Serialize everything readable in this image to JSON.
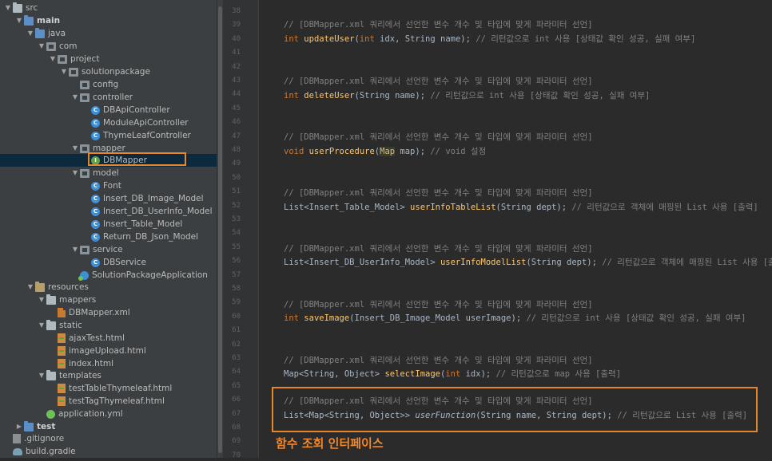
{
  "tree": {
    "items": [
      {
        "label": "src",
        "icon": "folder-icon",
        "indent": 0,
        "arrow": "down",
        "bold": false
      },
      {
        "label": "main",
        "icon": "srcfolder-icon",
        "indent": 1,
        "arrow": "down",
        "bold": true
      },
      {
        "label": "java",
        "icon": "srcfolder-icon",
        "indent": 2,
        "arrow": "down",
        "bold": false
      },
      {
        "label": "com",
        "icon": "pkg-icon",
        "indent": 3,
        "arrow": "down",
        "bold": false
      },
      {
        "label": "project",
        "icon": "pkg-icon",
        "indent": 4,
        "arrow": "down",
        "bold": false
      },
      {
        "label": "solutionpackage",
        "icon": "pkg-icon",
        "indent": 5,
        "arrow": "down",
        "bold": false
      },
      {
        "label": "config",
        "icon": "pkg-icon",
        "indent": 6,
        "arrow": "none",
        "bold": false
      },
      {
        "label": "controller",
        "icon": "pkg-icon",
        "indent": 6,
        "arrow": "down",
        "bold": false
      },
      {
        "label": "DBApiController",
        "icon": "class-icon",
        "indent": 7,
        "arrow": "none",
        "bold": false
      },
      {
        "label": "ModuleApiController",
        "icon": "class-icon",
        "indent": 7,
        "arrow": "none",
        "bold": false
      },
      {
        "label": "ThymeLeafController",
        "icon": "class-icon",
        "indent": 7,
        "arrow": "none",
        "bold": false
      },
      {
        "label": "mapper",
        "icon": "pkg-icon",
        "indent": 6,
        "arrow": "down",
        "bold": false
      },
      {
        "label": "DBMapper",
        "icon": "iface-icon",
        "indent": 7,
        "arrow": "none",
        "bold": false
      },
      {
        "label": "model",
        "icon": "pkg-icon",
        "indent": 6,
        "arrow": "down",
        "bold": false
      },
      {
        "label": "Font",
        "icon": "class-icon",
        "indent": 7,
        "arrow": "none",
        "bold": false
      },
      {
        "label": "Insert_DB_Image_Model",
        "icon": "class-icon",
        "indent": 7,
        "arrow": "none",
        "bold": false
      },
      {
        "label": "Insert_DB_UserInfo_Model",
        "icon": "class-icon",
        "indent": 7,
        "arrow": "none",
        "bold": false
      },
      {
        "label": "Insert_Table_Model",
        "icon": "class-icon",
        "indent": 7,
        "arrow": "none",
        "bold": false
      },
      {
        "label": "Return_DB_Json_Model",
        "icon": "class-icon",
        "indent": 7,
        "arrow": "none",
        "bold": false
      },
      {
        "label": "service",
        "icon": "pkg-icon",
        "indent": 6,
        "arrow": "down",
        "bold": false
      },
      {
        "label": "DBService",
        "icon": "class-icon",
        "indent": 7,
        "arrow": "none",
        "bold": false
      },
      {
        "label": "SolutionPackageApplication",
        "icon": "app-icon",
        "indent": 6,
        "arrow": "none",
        "bold": false
      },
      {
        "label": "resources",
        "icon": "resfolder-icon",
        "indent": 2,
        "arrow": "down",
        "bold": false
      },
      {
        "label": "mappers",
        "icon": "folder-icon",
        "indent": 3,
        "arrow": "down",
        "bold": false
      },
      {
        "label": "DBMapper.xml",
        "icon": "xml-icon",
        "indent": 4,
        "arrow": "none",
        "bold": false
      },
      {
        "label": "static",
        "icon": "folder-icon",
        "indent": 3,
        "arrow": "down",
        "bold": false
      },
      {
        "label": "ajaxTest.html",
        "icon": "html-icon",
        "indent": 4,
        "arrow": "none",
        "bold": false
      },
      {
        "label": "imageUpload.html",
        "icon": "html-icon",
        "indent": 4,
        "arrow": "none",
        "bold": false
      },
      {
        "label": "index.html",
        "icon": "html-icon",
        "indent": 4,
        "arrow": "none",
        "bold": false
      },
      {
        "label": "templates",
        "icon": "folder-icon",
        "indent": 3,
        "arrow": "down",
        "bold": false
      },
      {
        "label": "testTableThymeleaf.html",
        "icon": "html-icon",
        "indent": 4,
        "arrow": "none",
        "bold": false
      },
      {
        "label": "testTagThymeleaf.html",
        "icon": "html-icon",
        "indent": 4,
        "arrow": "none",
        "bold": false
      },
      {
        "label": "application.yml",
        "icon": "yml-icon",
        "indent": 3,
        "arrow": "none",
        "bold": false
      },
      {
        "label": "test",
        "icon": "srcfolder-icon",
        "indent": 1,
        "arrow": "right",
        "bold": true
      },
      {
        "label": ".gitignore",
        "icon": "git-icon",
        "indent": 0,
        "arrow": "none",
        "bold": false
      },
      {
        "label": "build.gradle",
        "icon": "gradle-icon",
        "indent": 0,
        "arrow": "none",
        "bold": false
      }
    ]
  },
  "gutter": {
    "line_numbers": [
      "38",
      "39",
      "40",
      "41",
      "42",
      "43",
      "44",
      "45",
      "46",
      "47",
      "48",
      "49",
      "50",
      "51",
      "52",
      "53",
      "54",
      "55",
      "56",
      "57",
      "58",
      "59",
      "60",
      "61",
      "62",
      "63",
      "64",
      "65",
      "66",
      "67",
      "68",
      "69",
      "70"
    ]
  },
  "editor": {
    "lines": [
      {
        "line": "39",
        "parts": [
          [
            "cmt",
            "// [DBMapper.xml 쿼리에서 선언한 변수 개수 및 타입에 맞게 파라미터 선언]"
          ]
        ]
      },
      {
        "line": "40",
        "parts": [
          [
            "kw",
            "int "
          ],
          [
            "fn",
            "updateUser"
          ],
          [
            "tp",
            "("
          ],
          [
            "kw",
            "int "
          ],
          [
            "tp",
            "idx, String name); "
          ],
          [
            "cmt",
            "// 리턴값으로 int 사용 [상태값 확인 성공, 실패 여부]"
          ]
        ]
      },
      {
        "line": "44",
        "parts": [
          [
            "cmt",
            "// [DBMapper.xml 쿼리에서 선언한 변수 개수 및 타입에 맞게 파라미터 선언]"
          ]
        ]
      },
      {
        "line": "45",
        "parts": [
          [
            "kw",
            "int "
          ],
          [
            "fn",
            "deleteUser"
          ],
          [
            "tp",
            "(String name); "
          ],
          [
            "cmt",
            "// 리턴값으로 int 사용 [상태값 확인 성공, 실패 여부]"
          ]
        ]
      },
      {
        "line": "49",
        "parts": [
          [
            "cmt",
            "// [DBMapper.xml 쿼리에서 선언한 변수 개수 및 타입에 맞게 파라미터 선언]"
          ]
        ]
      },
      {
        "line": "50",
        "parts": [
          [
            "kw",
            "void "
          ],
          [
            "fn",
            "userProcedure"
          ],
          [
            "tp",
            "("
          ],
          [
            "hl",
            "Map"
          ],
          [
            "tp",
            " map); "
          ],
          [
            "cmt",
            "// void 설정"
          ]
        ]
      },
      {
        "line": "54",
        "parts": [
          [
            "cmt",
            "// [DBMapper.xml 쿼리에서 선언한 변수 개수 및 타입에 맞게 파라미터 선언]"
          ]
        ]
      },
      {
        "line": "55",
        "parts": [
          [
            "tp",
            "List<Insert_Table_Model> "
          ],
          [
            "fn",
            "userInfoTableList"
          ],
          [
            "tp",
            "(String dept); "
          ],
          [
            "cmt",
            "// 리턴값으로 객체에 매핑된 List 사용 [출력]"
          ]
        ]
      },
      {
        "line": "59",
        "parts": [
          [
            "cmt",
            "// [DBMapper.xml 쿼리에서 선언한 변수 개수 및 타입에 맞게 파라미터 선언]"
          ]
        ]
      },
      {
        "line": "60",
        "parts": [
          [
            "tp",
            "List<Insert_DB_UserInfo_Model> "
          ],
          [
            "fn",
            "userInfoModelList"
          ],
          [
            "tp",
            "(String dept); "
          ],
          [
            "cmt",
            "// 리턴값으로 객체에 매핑된 List 사용 [출력]"
          ]
        ]
      },
      {
        "line": "64",
        "parts": [
          [
            "cmt",
            "// [DBMapper.xml 쿼리에서 선언한 변수 개수 및 타입에 맞게 파라미터 선언]"
          ]
        ]
      },
      {
        "line": "65",
        "parts": [
          [
            "kw",
            "int "
          ],
          [
            "fn",
            "saveImage"
          ],
          [
            "tp",
            "(Insert_DB_Image_Model userImage); "
          ],
          [
            "cmt",
            "// 리턴값으로 int 사용 [상태값 확인 성공, 실패 여부]"
          ]
        ]
      },
      {
        "line": "69",
        "parts": [
          [
            "cmt",
            "// [DBMapper.xml 쿼리에서 선언한 변수 개수 및 타입에 맞게 파라미터 선언]"
          ]
        ]
      },
      {
        "line": "70",
        "parts": [
          [
            "tp",
            "Map<String, Object> "
          ],
          [
            "fn",
            "selectImage"
          ],
          [
            "tp",
            "("
          ],
          [
            "kw",
            "int "
          ],
          [
            "tp",
            "idx); "
          ],
          [
            "cmt",
            "// 리턴값으로 map 사용 [출력]"
          ]
        ]
      },
      {
        "line": "74",
        "parts": [
          [
            "cmt",
            "// [DBMapper.xml 쿼리에서 선언한 변수 개수 및 타입에 맞게 파라미터 선언]"
          ]
        ]
      },
      {
        "line": "75",
        "parts": [
          [
            "tp",
            "List<Map<String, Object>> "
          ],
          [
            "ital",
            "userFunction"
          ],
          [
            "tp",
            "(String name, String dept); "
          ],
          [
            "cmt",
            "// 리턴값으로 List 사용 [출력]"
          ]
        ]
      }
    ],
    "closing_brace": "}"
  },
  "caption": "함수 조회 인터페이스",
  "colors": {
    "accent": "#e8862a",
    "keyword": "#cc7832",
    "function": "#ffc66d",
    "comment": "#808080",
    "selection": "#0d293e"
  }
}
